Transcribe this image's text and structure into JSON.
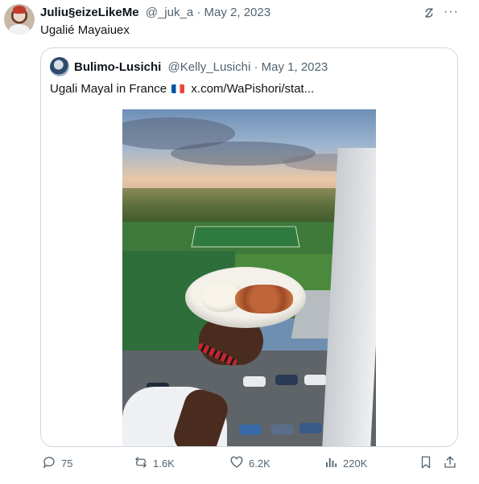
{
  "author": {
    "name": "Juliu§eizeLikeMe",
    "handle": "@_juk_a",
    "date": "May 2, 2023",
    "text": "Ugalié Mayaiuex"
  },
  "quoted": {
    "name": "Bulimo-Lusichi",
    "handle": "@Kelly_Lusichi",
    "date": "May 1, 2023",
    "text_before_flag": "Ugali Mayal in France",
    "link": "x.com/WaPishori/stat..."
  },
  "separator": "·",
  "more_label": "···",
  "actions": {
    "replies": "75",
    "reposts": "1.6K",
    "likes": "6.2K",
    "views": "220K"
  },
  "icons": {
    "grok": "grok-icon",
    "more": "more-icon",
    "reply": "reply-icon",
    "repost": "repost-icon",
    "like": "heart-icon",
    "views": "views-icon",
    "bookmark": "bookmark-icon",
    "share": "share-icon"
  },
  "colors": {
    "text": "#0f1419",
    "secondary": "#536471",
    "border": "#cfd9de"
  }
}
